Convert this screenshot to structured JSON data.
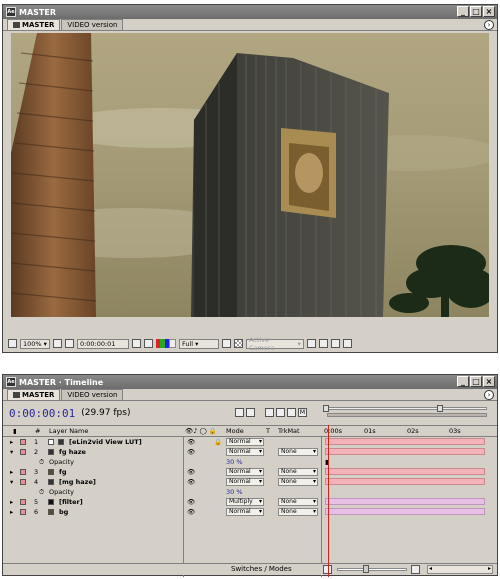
{
  "composition_window": {
    "title": "MASTER",
    "tabs": [
      {
        "label": "MASTER"
      },
      {
        "label": "VIDEO version"
      }
    ],
    "viewer_controls": {
      "zoom": "100%",
      "timecode": "0:00:00:01",
      "resolution": "Full",
      "camera": "Active Camera"
    }
  },
  "timeline_window": {
    "title": "MASTER · Timeline",
    "tabs": [
      {
        "label": "MASTER"
      },
      {
        "label": "VIDEO version"
      }
    ],
    "timecode": "0:00:00:01",
    "fps": "(29.97 fps)",
    "columns": {
      "num": "#",
      "layer_name": "Layer Name",
      "mode": "Mode",
      "t": "T",
      "trkmat": "TrkMat"
    },
    "ruler": [
      "0:00s",
      "01s",
      "02s",
      "03s"
    ],
    "layers": [
      {
        "num": "1",
        "name": "[eLin2vid View LUT]",
        "mode": "Normal",
        "trkmat": ""
      },
      {
        "num": "2",
        "name": "fg haze",
        "mode": "Normal",
        "trkmat": "None"
      },
      {
        "sub": "Opacity",
        "value": "30 %"
      },
      {
        "num": "3",
        "name": "fg",
        "mode": "Normal",
        "trkmat": "None"
      },
      {
        "num": "4",
        "name": "[mg haze]",
        "mode": "Normal",
        "trkmat": "None"
      },
      {
        "sub": "Opacity",
        "value": "30 %"
      },
      {
        "num": "5",
        "name": "[filter]",
        "mode": "Multiply",
        "trkmat": "None"
      },
      {
        "num": "6",
        "name": "bg",
        "mode": "Normal",
        "trkmat": "None"
      }
    ],
    "footer": "Switches / Modes"
  },
  "colors": {
    "timecode": "#2a2a9a",
    "bar_pink": "#f3b3b8",
    "bar_purple": "#e8c0e6",
    "label_red": "#e88f99"
  }
}
